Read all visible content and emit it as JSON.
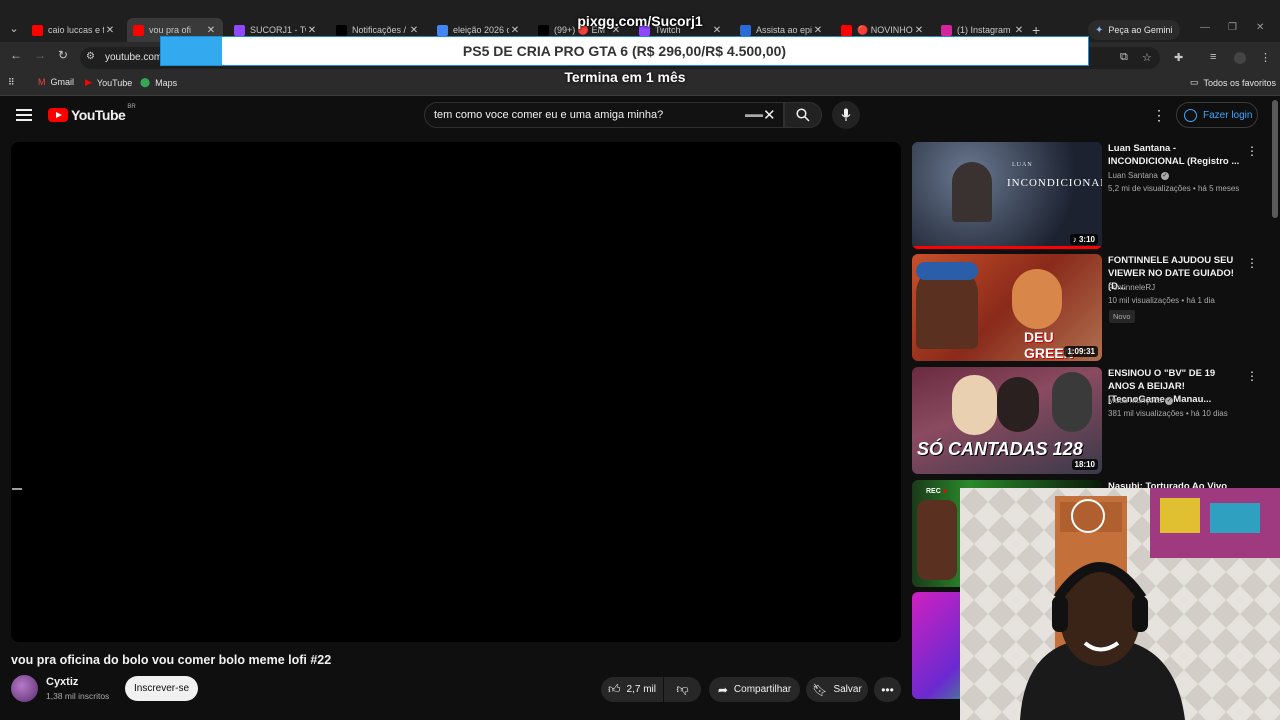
{
  "stream": {
    "donation_url": "pixgg.com/Sucorj1",
    "promo": {
      "text": "PS5 DE CRIA PRO GTA 6 (R$ 296,00/R$ 4.500,00)",
      "raised": 296.0,
      "goal": 4500.0
    },
    "promo_ends": "Termina em 1 mês"
  },
  "browser": {
    "tabs": [
      {
        "label": "caio luccas e fe",
        "icon": "youtube-icon",
        "color": "#ff0000"
      },
      {
        "label": "vou pra ofi",
        "icon": "youtube-icon",
        "color": "#ff0000",
        "active": true
      },
      {
        "label": "SUCORJ1 - Twi",
        "icon": "twitch-icon",
        "color": "#9146ff"
      },
      {
        "label": "Notificações /",
        "icon": "x-icon",
        "color": "#000000"
      },
      {
        "label": "eleição 2026 d",
        "icon": "google-icon",
        "color": "#4285f4"
      },
      {
        "label": "(99+) 🔴 EM",
        "icon": "tiktok-icon",
        "color": "#000000"
      },
      {
        "label": "Twitch",
        "icon": "twitch-icon",
        "color": "#9146ff"
      },
      {
        "label": "Assista ao epis",
        "icon": "streaming-icon",
        "color": "#2a6bd6"
      },
      {
        "label": "🔴 NOVINHO,",
        "icon": "youtube-icon",
        "color": "#ff0000"
      },
      {
        "label": "(1) Instagram",
        "icon": "instagram-icon",
        "color": "#d6249f"
      }
    ],
    "gemini_label": "Peça ao Gemini",
    "url": "youtube.com",
    "bookmarks": [
      {
        "label": "Gmail",
        "icon": "gmail-icon"
      },
      {
        "label": "YouTube",
        "icon": "youtube-icon"
      },
      {
        "label": "Maps",
        "icon": "maps-icon"
      }
    ],
    "all_bookmarks": "Todos os favoritos"
  },
  "youtube": {
    "logo_text": "YouTube",
    "country_code": "BR",
    "search_query": "tem como voce comer eu e uma amiga minha?",
    "login_label": "Fazer login",
    "video": {
      "title": "vou pra oficina do bolo vou comer bolo meme lofi #22",
      "channel": "Cyxtiz",
      "subscribers": "1,38 mil inscritos",
      "subscribe_label": "Inscrever-se",
      "likes": "2,7 mil",
      "share_label": "Compartilhar",
      "save_label": "Salvar"
    },
    "recommendations": [
      {
        "title": "Luan Santana - INCONDICIONAL (Registro ...",
        "channel": "Luan Santana",
        "verified": true,
        "meta": "5,2 mi de visualizações • há 5 meses",
        "duration": "3:10",
        "thumb_text": "INCONDICIONAL",
        "watched": 1.0
      },
      {
        "title": "FONTINNELE AJUDOU SEU VIEWER NO DATE GUIADO! (D...",
        "channel": "FontinneleRJ",
        "verified": false,
        "meta": "10 mil visualizações • há 1 dia",
        "duration": "1:09:31",
        "badge": "Novo",
        "thumb_text": "DEU GREEN"
      },
      {
        "title": "ENSINOU O \"BV\" DE 19 ANOS A BEIJAR! [TecnoGame - Manau...",
        "channel": "Muca Muriçoca",
        "verified": true,
        "meta": "381 mil visualizações • há 10 dias",
        "duration": "18:10",
        "thumb_text": "SÓ CANTADAS 128"
      },
      {
        "title": "Nasubi: Torturado Ao Vivo Por",
        "live_badge": "REC"
      }
    ]
  },
  "colors": {
    "youtube_red": "#ff0000",
    "link_blue": "#3ea6ff",
    "promo_blue": "#33aaf0"
  }
}
